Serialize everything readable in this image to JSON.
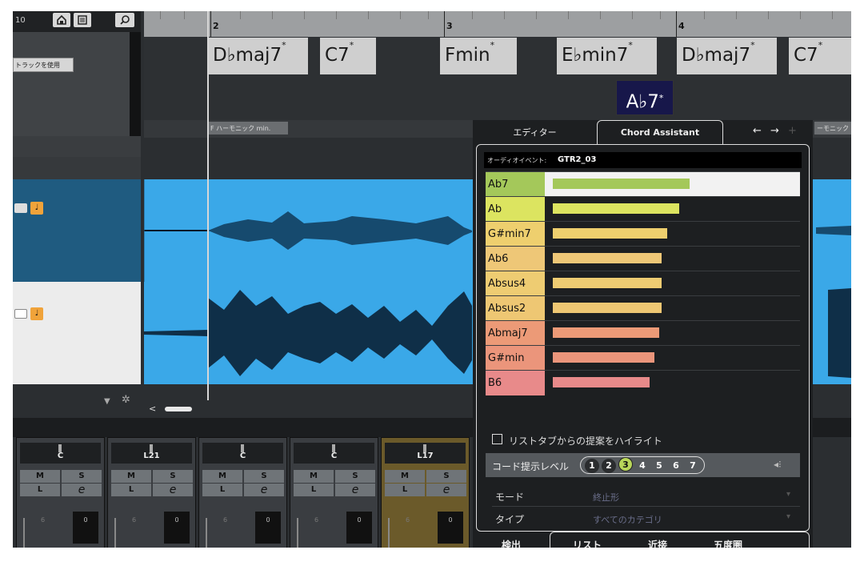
{
  "toolbar": {
    "counter": "10",
    "home_icon": "home-icon",
    "list_icon": "list-icon",
    "search_icon": "search-icon"
  },
  "left_panel": {
    "use_track_label": "トラックを使用"
  },
  "ruler": {
    "bars": [
      "2",
      "3",
      "4"
    ]
  },
  "chords": {
    "c1": {
      "root": "D♭maj7",
      "mark": "*"
    },
    "c2": {
      "root": "C7",
      "mark": "*"
    },
    "c3": {
      "root": "Fmin",
      "mark": "*"
    },
    "c4": {
      "root": "E♭min7",
      "mark": "*"
    },
    "c5": {
      "root": "D♭maj7",
      "mark": "*"
    },
    "c6": {
      "root": "C7",
      "mark": "*"
    },
    "popup": {
      "root": "A♭7",
      "mark": "*"
    }
  },
  "scale_track": {
    "label1": "F ハーモニック min.",
    "label2": "ーモニック m"
  },
  "chord_assistant": {
    "tab_editor": "エディター",
    "tab_assistant": "Chord Assistant",
    "audio_event_label": "オーディオイベント:",
    "audio_event_value": "GTR2_03",
    "suggestions": [
      {
        "name": "Ab7",
        "score": 0.55,
        "color": "#a4c85a",
        "selected": true
      },
      {
        "name": "Ab",
        "score": 0.51,
        "color": "#dce460"
      },
      {
        "name": "G#min7",
        "score": 0.46,
        "color": "#eecf6e"
      },
      {
        "name": "Ab6",
        "score": 0.44,
        "color": "#eec777"
      },
      {
        "name": "Absus4",
        "score": 0.44,
        "color": "#eecc72"
      },
      {
        "name": "Absus2",
        "score": 0.44,
        "color": "#eec773"
      },
      {
        "name": "Abmaj7",
        "score": 0.43,
        "color": "#ec9a77"
      },
      {
        "name": "G#min",
        "score": 0.41,
        "color": "#eb957b"
      },
      {
        "name": "B6",
        "score": 0.39,
        "color": "#e88a8a"
      }
    ],
    "highlight_label": "リストタブからの提案をハイライト",
    "complexity_label": "コード提示レベル",
    "levels": [
      "1",
      "2",
      "3",
      "4",
      "5",
      "6",
      "7"
    ],
    "active_level": "3",
    "mode_label": "モード",
    "mode_value": "終止形",
    "type_label": "タイプ",
    "type_value": "すべてのカテゴリ",
    "bottom_tabs": [
      "検出",
      "リスト",
      "近接",
      "五度圏"
    ]
  },
  "mixer": {
    "channels": [
      {
        "pan": "C",
        "m": "M",
        "s": "S",
        "l": "L",
        "e": "e",
        "color": "#3a3d41"
      },
      {
        "pan": "L21",
        "m": "M",
        "s": "S",
        "l": "L",
        "e": "e",
        "color": "#3a3d41"
      },
      {
        "pan": "C",
        "m": "M",
        "s": "S",
        "l": "L",
        "e": "e",
        "color": "#3a3d41"
      },
      {
        "pan": "C",
        "m": "M",
        "s": "S",
        "l": "L",
        "e": "e",
        "color": "#3a3d41"
      },
      {
        "pan": "L17",
        "m": "M",
        "s": "S",
        "l": "L",
        "e": "e",
        "color": "#6b5a2a"
      }
    ],
    "fader_scale": "6",
    "fader_value": "0"
  }
}
